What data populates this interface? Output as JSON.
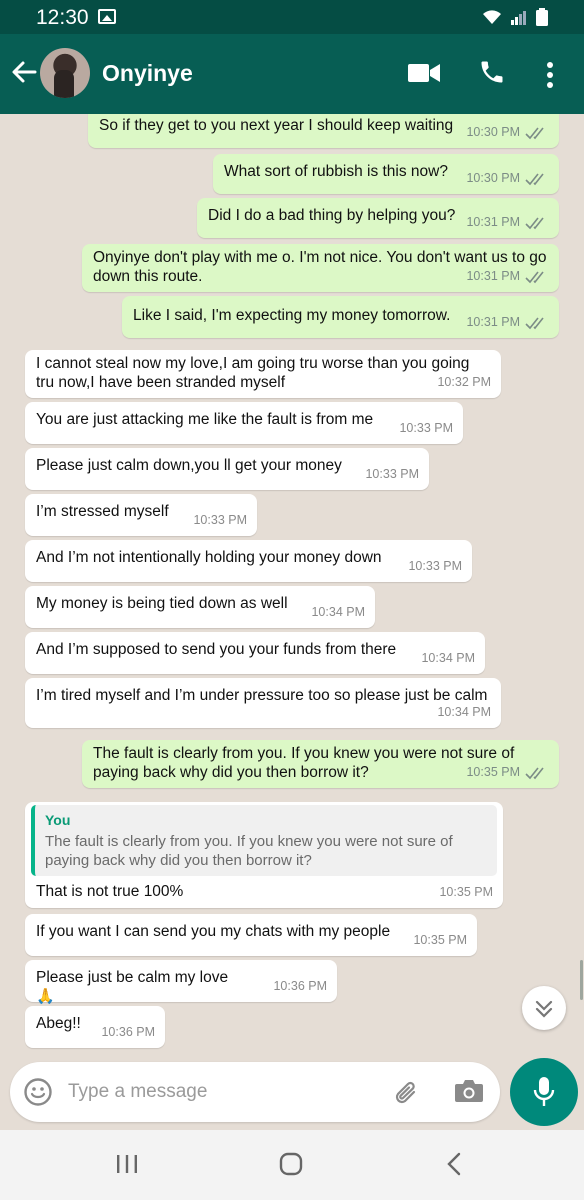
{
  "status_bar": {
    "time": "12:30"
  },
  "header": {
    "contact_name": "Onyinye"
  },
  "messages": [
    {
      "dir": "out",
      "text": "So if they get to you next year I should keep waiting",
      "time": "10:30 PM"
    },
    {
      "dir": "out",
      "text": "What sort of rubbish is this now?",
      "time": "10:30 PM"
    },
    {
      "dir": "out",
      "text": "Did I do a bad thing by helping you?",
      "time": "10:31 PM"
    },
    {
      "dir": "out",
      "text": "Onyinye don't play with me o. I'm not nice. You don't want us to go down this route.",
      "time": "10:31 PM"
    },
    {
      "dir": "out",
      "text": "Like I said, I'm expecting my money tomorrow.",
      "time": "10:31 PM"
    },
    {
      "dir": "in",
      "text": "I cannot steal now my love,I am going tru worse than you going tru now,I have been stranded myself",
      "time": "10:32 PM"
    },
    {
      "dir": "in",
      "text": "You are just attacking me like the fault is from me",
      "time": "10:33 PM"
    },
    {
      "dir": "in",
      "text": "Please just calm down,you ll get your money",
      "time": "10:33 PM"
    },
    {
      "dir": "in",
      "text": "I’m stressed myself",
      "time": "10:33 PM"
    },
    {
      "dir": "in",
      "text": "And I’m not intentionally holding your money down",
      "time": "10:33 PM"
    },
    {
      "dir": "in",
      "text": "My money is being tied down as well",
      "time": "10:34 PM"
    },
    {
      "dir": "in",
      "text": "And I’m supposed to send you your funds from there",
      "time": "10:34 PM"
    },
    {
      "dir": "in",
      "text": "I’m tired myself and I’m under pressure too so please just be calm",
      "time": "10:34 PM"
    },
    {
      "dir": "out",
      "text": "The fault is clearly from you. If you knew you were not sure of paying back why did you then borrow it?",
      "time": "10:35 PM"
    },
    {
      "dir": "in",
      "text": "That is not true 100%",
      "time": "10:35 PM",
      "quote_name": "You",
      "quote_text": "The fault is clearly from you. If you knew you were not sure of paying back why did you then borrow it?"
    },
    {
      "dir": "in",
      "text": "If you want I can send you my chats with my people",
      "time": "10:35 PM"
    },
    {
      "dir": "in",
      "text": "Please just be calm my love",
      "time": "10:36 PM"
    },
    {
      "dir": "in",
      "text": "Abeg!!",
      "time": "10:36 PM"
    }
  ],
  "composer": {
    "placeholder": "Type a message"
  },
  "colors": {
    "header": "#075e54",
    "outgoing_bubble": "#dcf8c6",
    "incoming_bubble": "#ffffff",
    "accent": "#00897b"
  },
  "icons": [
    "back-arrow-icon",
    "video-call-icon",
    "voice-call-icon",
    "more-options-icon",
    "emoji-icon",
    "attach-icon",
    "camera-icon",
    "mic-icon",
    "scroll-down-icon",
    "praying-hands-emoji"
  ]
}
